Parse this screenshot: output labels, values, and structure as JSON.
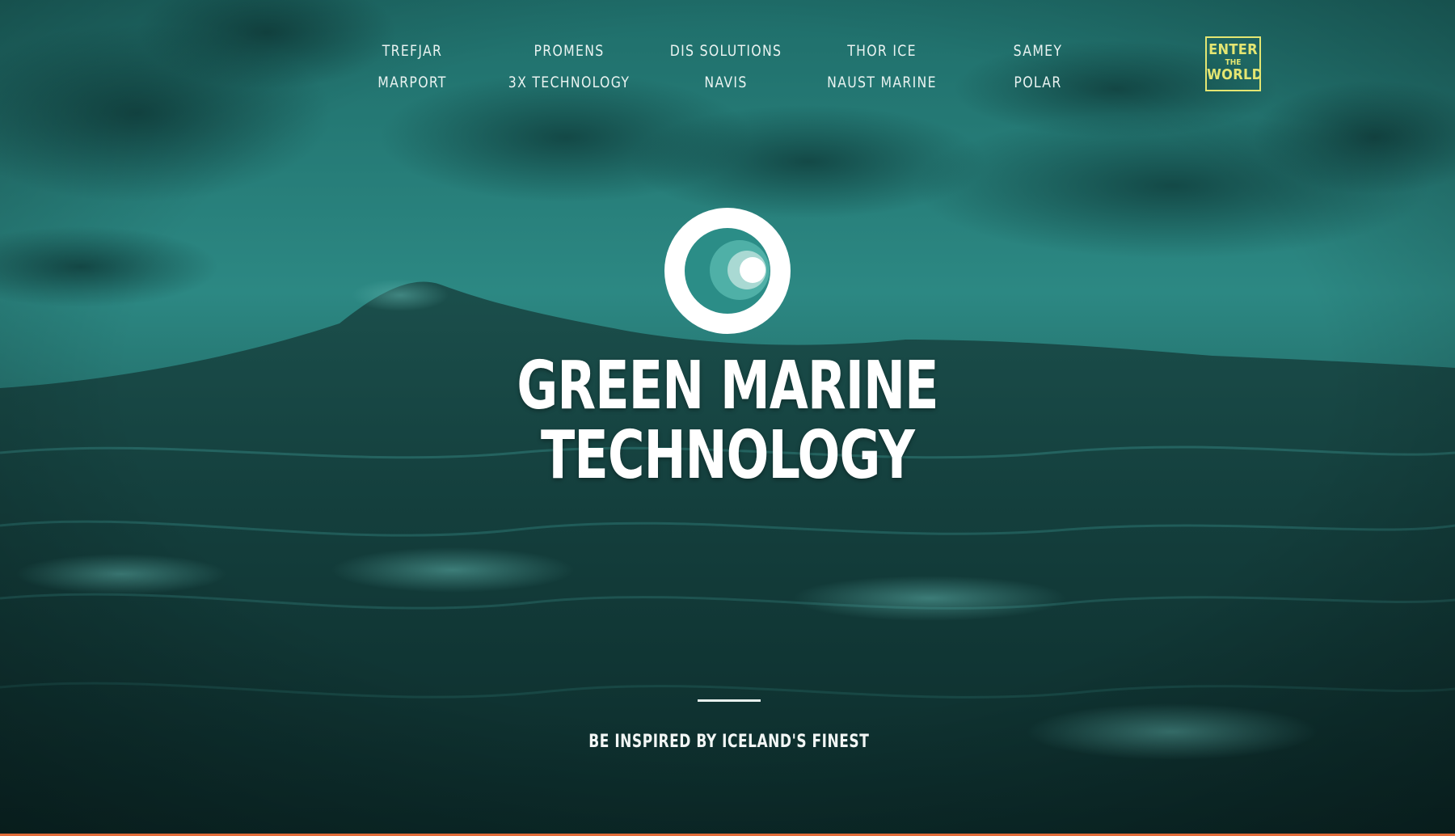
{
  "nav": {
    "columns": [
      {
        "top": "TREFJAR",
        "bottom": "MARPORT"
      },
      {
        "top": "PROMENS",
        "bottom": "3X TECHNOLOGY"
      },
      {
        "top": "DIS SOLUTIONS",
        "bottom": "NAVIS"
      },
      {
        "top": "THOR ICE",
        "bottom": "NAUST MARINE"
      },
      {
        "top": "SAMEY",
        "bottom": "POLAR"
      }
    ],
    "enter_button": {
      "line1": "ENTER",
      "line2": "THE",
      "line3": "WORLD"
    }
  },
  "brand": {
    "title_line1": "GREEN MARINE",
    "title_line2": "TECHNOLOGY",
    "tagline": "BE INSPIRED BY ICELAND'S FINEST"
  },
  "colors": {
    "accent_yellow": "#e4e672",
    "teal_dark": "#0f3432",
    "teal_mid": "#2f8a85",
    "logo_ring": "#ffffff",
    "bottom_rule": "#e26d3a"
  },
  "icons": {
    "logo": "concentric-wave-circle-icon"
  }
}
